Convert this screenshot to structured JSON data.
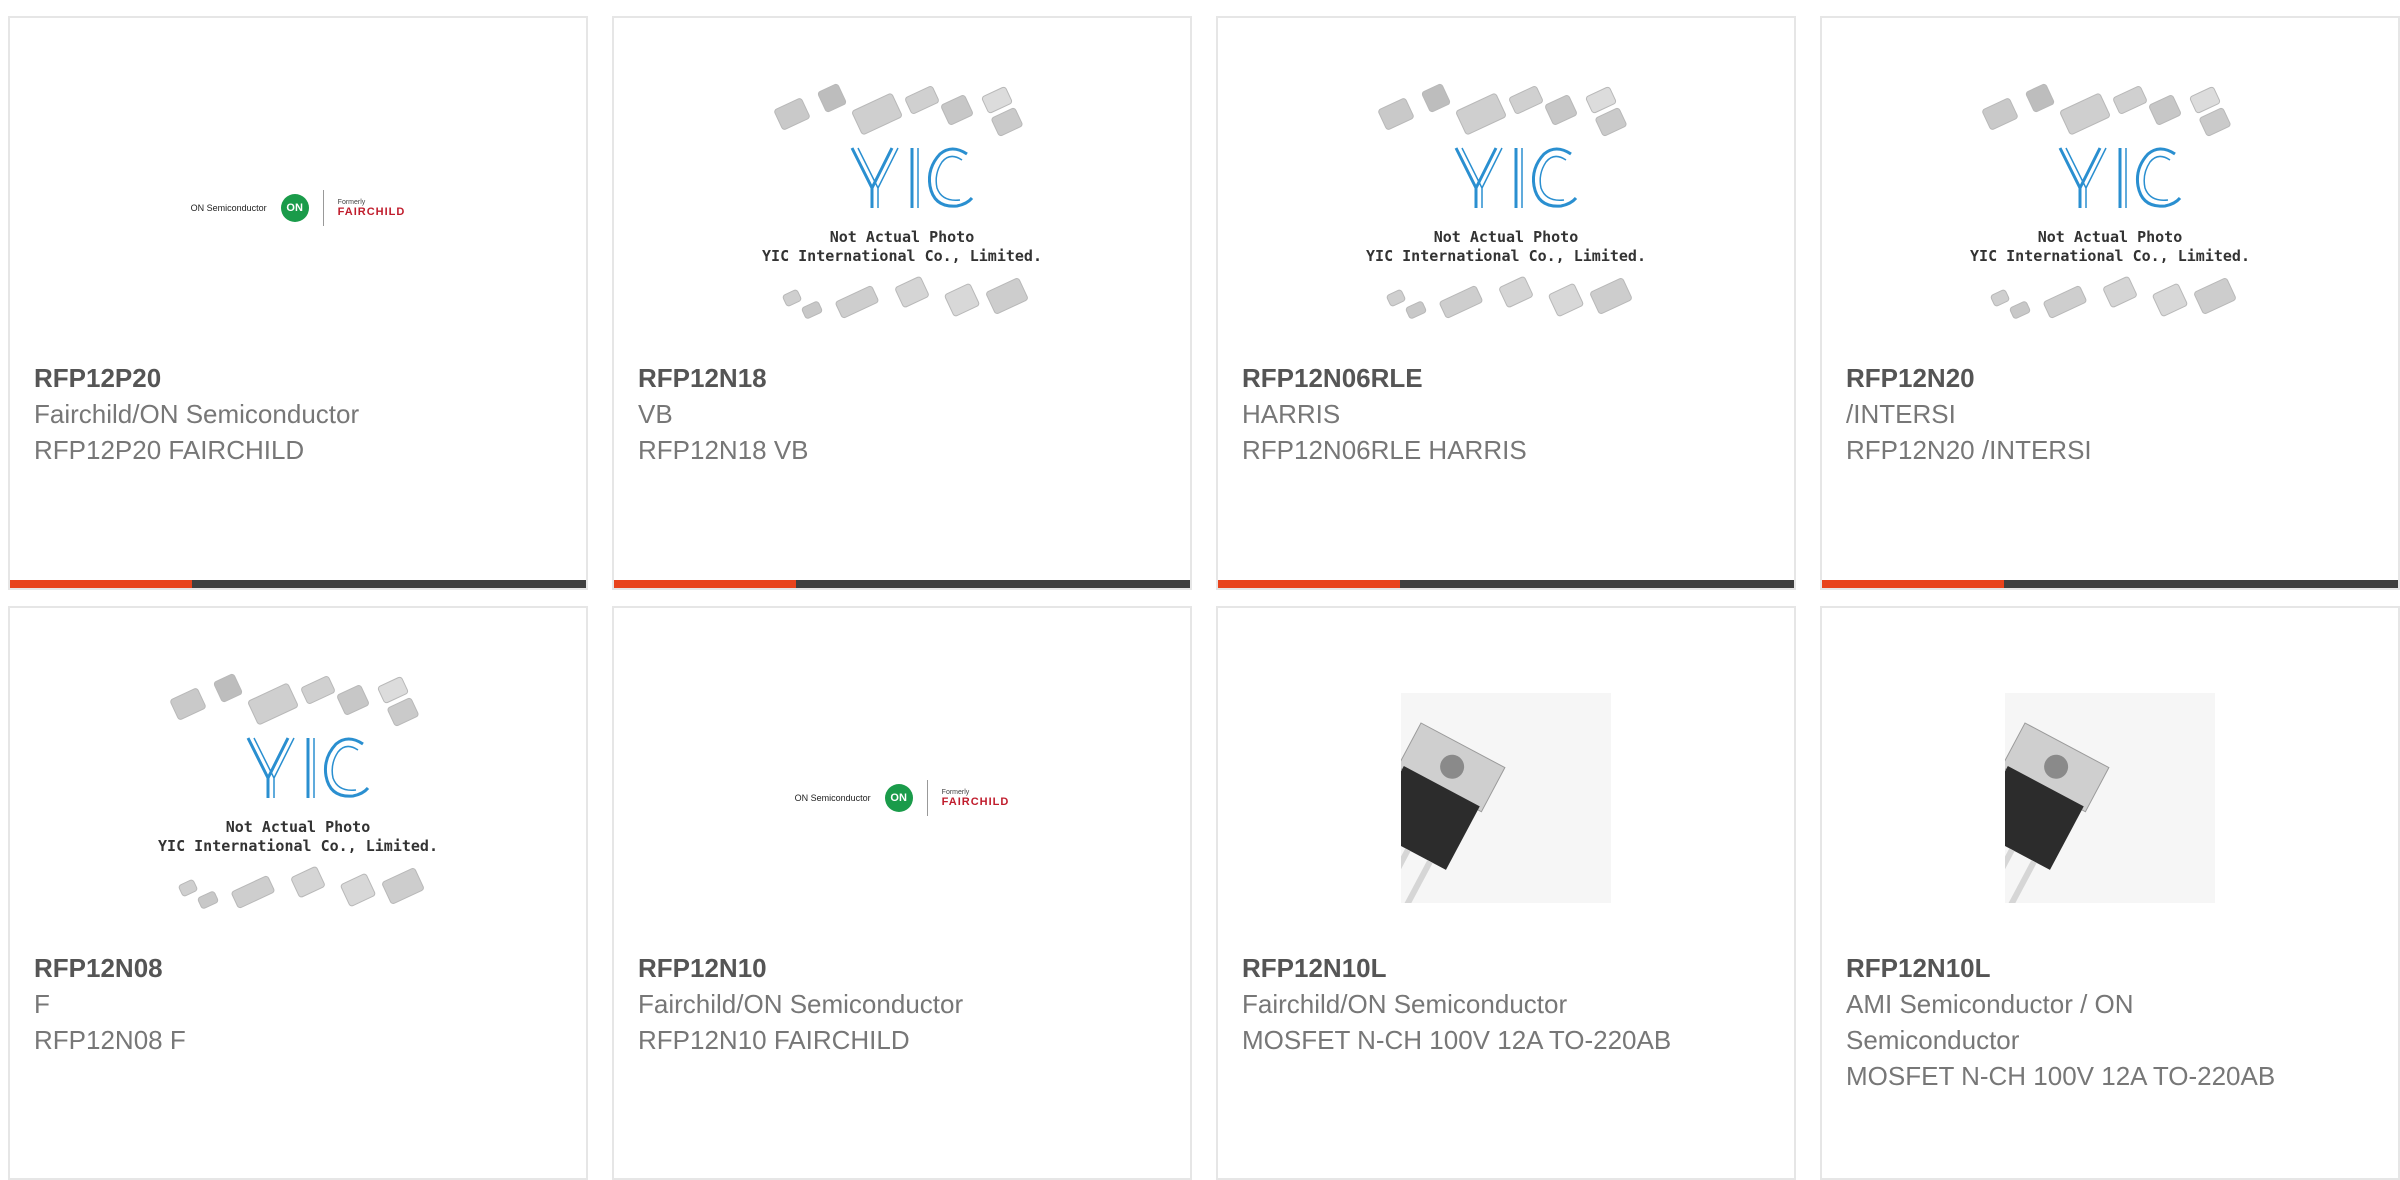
{
  "colors": {
    "accent": "#e8431c",
    "bar": "#3f3f3f",
    "card_border": "#e6e6e6",
    "part_number": "#555555",
    "text": "#777777"
  },
  "products": [
    {
      "part_number": "RFP12P20",
      "manufacturer": "Fairchild/ON Semiconductor",
      "description": "RFP12P20 FAIRCHILD",
      "image": "on-fairchild-logo"
    },
    {
      "part_number": "RFP12N18",
      "manufacturer": "VB",
      "description": "RFP12N18 VB",
      "image": "yic-placeholder"
    },
    {
      "part_number": "RFP12N06RLE",
      "manufacturer": "HARRIS",
      "description": "RFP12N06RLE HARRIS",
      "image": "yic-placeholder"
    },
    {
      "part_number": "RFP12N20",
      "manufacturer": "/INTERSI",
      "description": "RFP12N20 /INTERSI",
      "image": "yic-placeholder"
    },
    {
      "part_number": "RFP12N08",
      "manufacturer": "F",
      "description": "RFP12N08 F",
      "image": "yic-placeholder"
    },
    {
      "part_number": "RFP12N10",
      "manufacturer": "Fairchild/ON Semiconductor",
      "description": "RFP12N10 FAIRCHILD",
      "image": "on-fairchild-logo"
    },
    {
      "part_number": "RFP12N10L",
      "manufacturer": "Fairchild/ON Semiconductor",
      "description": "MOSFET N-CH 100V 12A TO-220AB",
      "image": "to220-transistor"
    },
    {
      "part_number": "RFP12N10L",
      "manufacturer": "AMI Semiconductor / ON Semiconductor",
      "description": "MOSFET N-CH 100V 12A TO-220AB",
      "image": "to220-transistor"
    }
  ],
  "image_text": {
    "on_logo_text": "ON Semiconductor",
    "on_badge": "ON",
    "formerly": "Formerly",
    "fairchild": "FAIRCHILD",
    "yic_line1": "Not Actual Photo",
    "yic_line2": "YIC International Co., Limited."
  }
}
